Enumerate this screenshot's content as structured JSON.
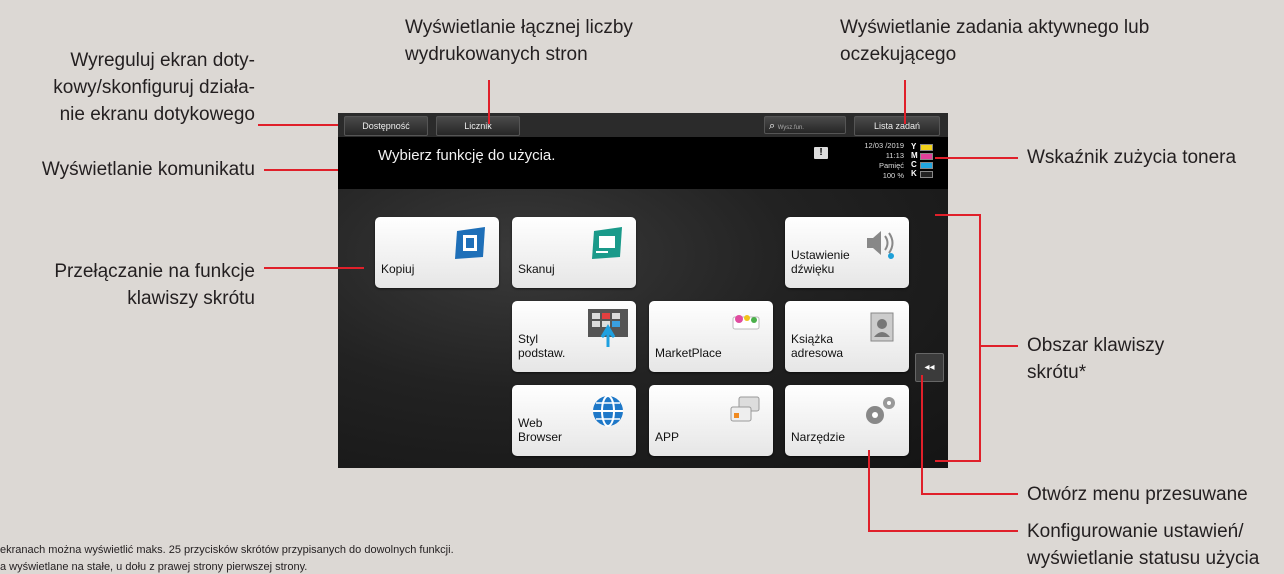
{
  "annotations": {
    "adjust_screen": [
      "Wyreguluj ekran doty-",
      "kowy/skonfiguruj działa-",
      "nie ekranu dotykowego"
    ],
    "message_display": "Wyświetlanie komunikatu",
    "switch_shortcut": [
      "Przełączanie na funkcje",
      "klawiszy skrótu"
    ],
    "total_pages": [
      "Wyświetlanie łącznej liczby",
      "wydrukowanych stron"
    ],
    "active_job": [
      "Wyświetlanie zadania aktywnego lub",
      "oczekującego"
    ],
    "toner_indicator": "Wskaźnik zużycia tonera",
    "shortcut_area": [
      "Obszar klawiszy",
      "skrótu*"
    ],
    "slide_menu": "Otwórz menu przesuwane",
    "configure_settings": [
      "Konfigurowanie ustawień/",
      "wyświetlanie statusu użycia"
    ]
  },
  "footnotes": [
    "ekranach można wyświetlić maks. 25 przycisków skrótów przypisanych do dowolnych funkcji.",
    "a wyświetlane na stałe, u dołu z prawej strony pierwszej strony."
  ],
  "screen": {
    "topbar": {
      "accessibility": "Dostępność",
      "counter": "Licznik",
      "search_placeholder": "Wysz.fun.",
      "job_list": "Lista zadań"
    },
    "message": "Wybierz funkcję do użycia.",
    "alert_symbol": "!",
    "status": {
      "date": "12/03 /2019",
      "time": "11:13",
      "memory_label": "Pamięć",
      "memory_value": "100 %"
    },
    "toner": [
      {
        "letter": "Y",
        "color": "#f2d21a"
      },
      {
        "letter": "M",
        "color": "#e0409a"
      },
      {
        "letter": "C",
        "color": "#21a6e0"
      },
      {
        "letter": "K",
        "color": "#222222"
      }
    ],
    "keys": {
      "copy": [
        "Kopiuj"
      ],
      "scan": [
        "Skanuj"
      ],
      "sound": [
        "Ustawienie",
        "dźwięku"
      ],
      "style": [
        "Styl",
        "podstaw."
      ],
      "marketplace": [
        "MarketPlace"
      ],
      "address_book": [
        "Książka",
        "adresowa"
      ],
      "web": [
        "Web",
        "Browser"
      ],
      "app": [
        "APP"
      ],
      "tools": [
        "Narzędzie"
      ]
    },
    "slide_arrow": "◂◂",
    "colors": {
      "accent_line": "#e0202a",
      "copy_icon": "#1e6fb8",
      "scan_icon": "#1a9a8a"
    }
  }
}
